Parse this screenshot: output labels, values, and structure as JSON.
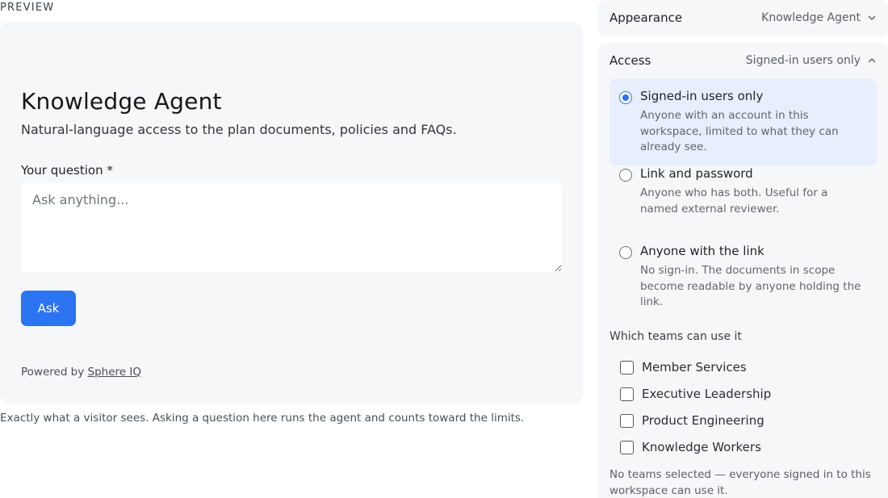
{
  "preview": {
    "label": "PREVIEW",
    "agent_title": "Knowledge Agent",
    "agent_description": "Natural-language access to the plan documents, policies and FAQs.",
    "question_label": "Your question *",
    "question_placeholder": "Ask anything...",
    "question_value": "",
    "ask_label": "Ask",
    "powered_prefix": "Powered by ",
    "powered_link": "Sphere IQ",
    "caption": "Exactly what a visitor sees. Asking a question here runs the agent and counts toward the limits."
  },
  "appearance": {
    "title": "Appearance",
    "value": "Knowledge Agent",
    "expanded": false
  },
  "access": {
    "title": "Access",
    "value": "Signed-in users only",
    "expanded": true,
    "accent_color": "#2d74f2",
    "options": [
      {
        "title": "Signed-in users only",
        "description": "Anyone with an account in this workspace, limited to what they can already see.",
        "selected": true
      },
      {
        "title": "Link and password",
        "description": "Anyone who has both. Useful for a named external reviewer.",
        "selected": false
      },
      {
        "title": "Anyone with the link",
        "description": "No sign-in. The documents in scope become readable by anyone holding the link.",
        "selected": false
      }
    ],
    "teams_label": "Which teams can use it",
    "teams": [
      {
        "label": "Member Services",
        "checked": false
      },
      {
        "label": "Executive Leadership",
        "checked": false
      },
      {
        "label": "Product Engineering",
        "checked": false
      },
      {
        "label": "Knowledge Workers",
        "checked": false
      }
    ],
    "teams_note": "No teams selected — everyone signed in to this workspace can use it."
  }
}
